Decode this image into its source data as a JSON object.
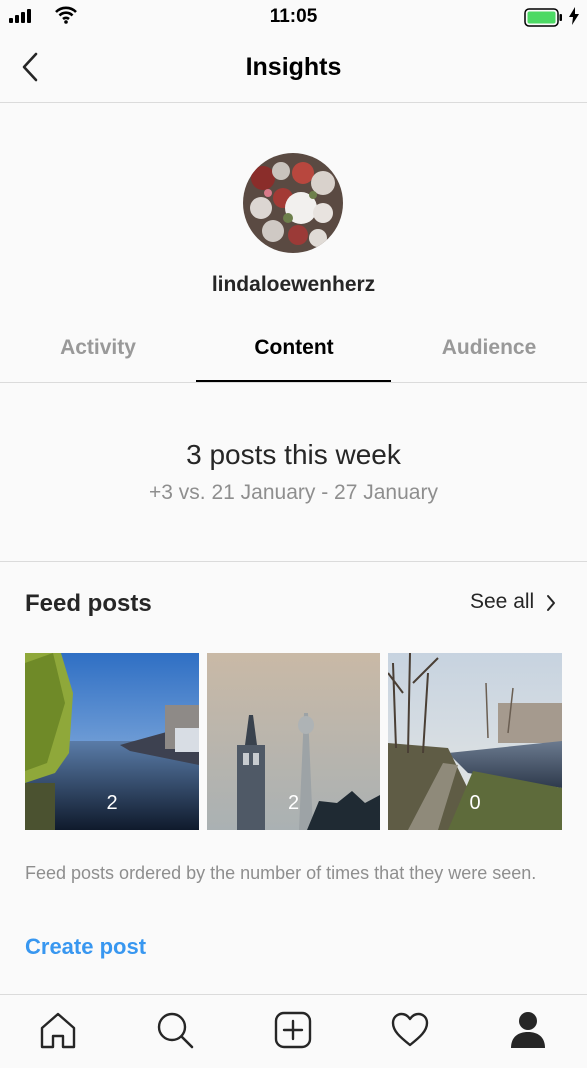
{
  "status_bar": {
    "time": "11:05",
    "battery_color": "#4cd964"
  },
  "nav": {
    "title": "Insights",
    "back_icon": "chevron-left-icon"
  },
  "profile": {
    "username": "lindaloewenherz"
  },
  "tabs": [
    {
      "label": "Activity",
      "active": false
    },
    {
      "label": "Content",
      "active": true
    },
    {
      "label": "Audience",
      "active": false
    }
  ],
  "summary": {
    "title": "3 posts this week",
    "subtitle": "+3 vs. 21 January - 27 January"
  },
  "feed_posts": {
    "title": "Feed posts",
    "see_all": "See all",
    "posts": [
      {
        "count": "2",
        "description": "canal with willow tree and boats"
      },
      {
        "count": "2",
        "description": "church spire and TV tower in fog"
      },
      {
        "count": "0",
        "description": "canal promenade with bare trees"
      }
    ],
    "caption": "Feed posts ordered by the number of times that they were seen.",
    "create_post": "Create post"
  },
  "bottom_tabs": [
    {
      "icon": "home-icon"
    },
    {
      "icon": "search-icon"
    },
    {
      "icon": "add-post-icon"
    },
    {
      "icon": "heart-icon"
    },
    {
      "icon": "profile-icon",
      "active": true
    }
  ],
  "colors": {
    "accent": "#3897f0",
    "text": "#262626",
    "muted": "#8e8e8e",
    "border": "#dbdbdb"
  }
}
